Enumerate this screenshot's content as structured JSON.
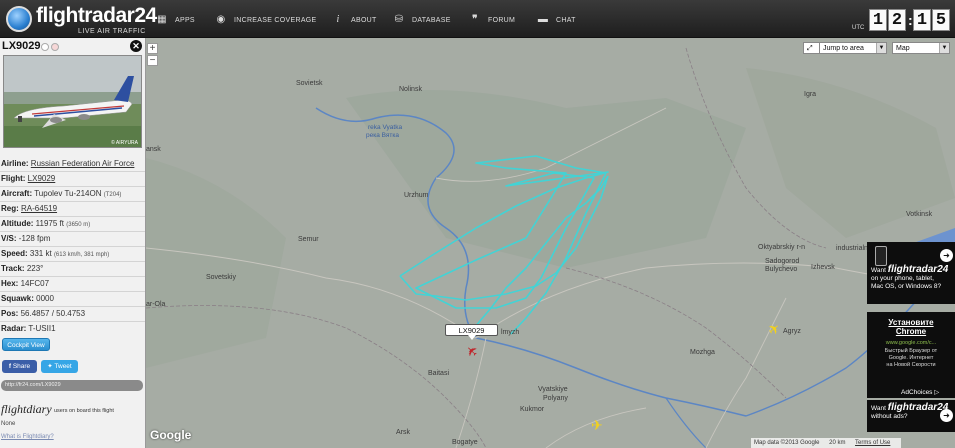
{
  "header": {
    "logo_name": "flightradar24",
    "logo_tagline": "LIVE AIR TRAFFIC",
    "nav": [
      {
        "label": "APPS",
        "icon": "apps-grid-icon"
      },
      {
        "label": "INCREASE COVERAGE",
        "icon": "eye-icon"
      },
      {
        "label": "ABOUT",
        "icon": "info-icon"
      },
      {
        "label": "DATABASE",
        "icon": "database-icon"
      },
      {
        "label": "FORUM",
        "icon": "quote-icon"
      },
      {
        "label": "CHAT",
        "icon": "chat-bubble-icon"
      }
    ],
    "utc_label": "UTC",
    "clock": {
      "h1": "1",
      "h2": "2",
      "m1": "1",
      "m2": "5"
    }
  },
  "panel": {
    "title": "LX9029",
    "photo_credit": "© AIRYURA",
    "fields": {
      "airline_label": "Airline:",
      "airline": "Russian Federation Air Force",
      "flight_label": "Flight:",
      "flight": "LX9029",
      "aircraft_label": "Aircraft:",
      "aircraft": "Tupolev Tu-214ON",
      "aircraft_code": "(T204)",
      "reg_label": "Reg:",
      "reg": "RA-64519",
      "altitude_label": "Altitude:",
      "altitude": "11975 ft",
      "altitude_m": "(3650 m)",
      "vs_label": "V/S:",
      "vs": "-128 fpm",
      "speed_label": "Speed:",
      "speed": "331 kt",
      "speed_alt": "(613 km/h, 381 mph)",
      "track_label": "Track:",
      "track": "223°",
      "hex_label": "Hex:",
      "hex": "14FC07",
      "squawk_label": "Squawk:",
      "squawk": "0000",
      "pos_label": "Pos:",
      "pos": "56.4857 / 50.4753",
      "radar_label": "Radar:",
      "radar": "T-USII1"
    },
    "cockpit_view": "Cockpit View",
    "share": "Share",
    "tweet": "Tweet",
    "link": "http://fr24.com/LX9029",
    "flightdiary_logo": "flightdiary",
    "flightdiary_users": "users on board this flight",
    "flightdiary_none": "None",
    "flightdiary_what": "What is Flightdiary?"
  },
  "map": {
    "jump_to_area": "Jump to area",
    "map_type": "Map",
    "zoom_in": "+",
    "zoom_out": "−",
    "flight_label": "LX9029",
    "places": [
      {
        "name": "Sovietsk"
      },
      {
        "name": "Nolinsk"
      },
      {
        "name": "reka Vyatka"
      },
      {
        "name": "река Вятка"
      },
      {
        "name": "ansk"
      },
      {
        "name": "Urzhum"
      },
      {
        "name": "Semur"
      },
      {
        "name": "Sovetskiy"
      },
      {
        "name": "ar-Ola"
      },
      {
        "name": "Baitasi"
      },
      {
        "name": "lmyzh"
      },
      {
        "name": "Vyatskiye"
      },
      {
        "name": "Polyany"
      },
      {
        "name": "Kukmor"
      },
      {
        "name": "Arsk"
      },
      {
        "name": "Bogatye"
      },
      {
        "name": "Igra"
      },
      {
        "name": "Votkinsk"
      },
      {
        "name": "Oktyabrskiy r-n"
      },
      {
        "name": "Sadogorod"
      },
      {
        "name": "Bulychevo"
      },
      {
        "name": "Izhevsk"
      },
      {
        "name": "industrialniy"
      },
      {
        "name": "Mozhga"
      },
      {
        "name": "Agryz"
      }
    ],
    "google": "Google",
    "map_data": "Map data ©2013 Google",
    "scale": "20 km",
    "terms": "Terms of Use"
  },
  "ads": {
    "fr24_apps": {
      "want": "Want",
      "brand": "flightradar24",
      "line2": "on your phone, tablet,",
      "line3": "Mac OS, or Windows 8?"
    },
    "chrome": {
      "title1": "Установите",
      "title2": "Chrome",
      "url": "www.google.com/c...",
      "body1": "Быстрый Браузер от",
      "body2": "Google. Интернет",
      "body3": "на Новой Скорости",
      "adchoices": "AdChoices ▷"
    },
    "no_ads": {
      "want": "Want",
      "brand": "flightradar24",
      "line2": "without ads?"
    }
  },
  "colors": {
    "track": "#3ed6d8",
    "selected_plane": "#c0262b",
    "other_plane": "#f3d21a",
    "map_land": "#a9aea8"
  }
}
